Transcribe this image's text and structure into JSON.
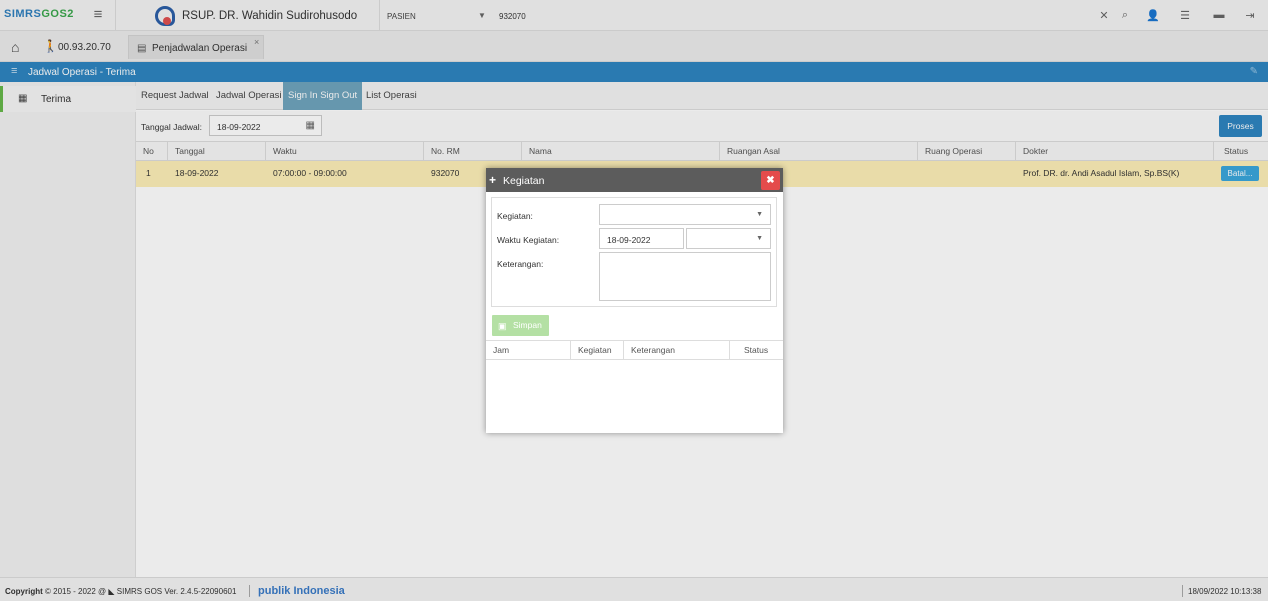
{
  "topbar": {
    "logo_a": "SIMRS",
    "logo_b": "GOS2",
    "hospital_name": "RSUP. DR. Wahidin Sudirohusodo",
    "pasien_label": "PASIEN",
    "pasien_value": "932070",
    "tools": [
      "close-icon",
      "search-icon",
      "add-user-icon",
      "list-icon",
      "folder-icon",
      "logout-icon"
    ]
  },
  "bar2": {
    "rm_text": "00.93.20.70",
    "tab_label": "Penjadwalan Operasi",
    "tab_close": "×"
  },
  "title_bar": {
    "text": "Jadwal Operasi - Terima"
  },
  "sidebar": {
    "items": [
      {
        "label": "Terima"
      }
    ]
  },
  "subtabs": [
    {
      "label": "Request Jadwal",
      "active": false
    },
    {
      "label": "Jadwal Operasi",
      "active": false
    },
    {
      "label": "Sign In Sign Out",
      "active": true
    },
    {
      "label": "List Operasi",
      "active": false
    }
  ],
  "filter": {
    "label": "Tanggal Jadwal:",
    "date": "18-09-2022",
    "proses": "Proses"
  },
  "table": {
    "headers": [
      "No",
      "Tanggal",
      "Waktu",
      "No. RM",
      "Nama",
      "Ruangan Asal",
      "Ruang Operasi",
      "Dokter",
      "Status"
    ],
    "row": {
      "no": "1",
      "tanggal": "18-09-2022",
      "waktu": "07:00:00 - 09:00:00",
      "no_rm": "932070",
      "nama": "",
      "ruangan_asal": "",
      "ruang_operasi": "",
      "dokter": "Prof. DR. dr. Andi Asadul Islam, Sp.BS(K)",
      "status": "Batal..."
    }
  },
  "modal": {
    "title": "Kegiatan",
    "close": "✖",
    "kegiatan_label": "Kegiatan:",
    "waktu_label": "Waktu Kegiatan:",
    "waktu_date": "18-09-2022",
    "keterangan_label": "Keterangan:",
    "simpan": "Simpan",
    "table_headers": [
      "Jam",
      "Kegiatan",
      "Keterangan",
      "Status"
    ]
  },
  "footer": {
    "copyright_bold": "Copyright",
    "copyright_rest": "2015 - 2022 @",
    "version": "SIMRS GOS Ver. 2.4.5-22090601",
    "brand": "publik Indonesia",
    "datetime": "18/09/2022 10:13:38"
  }
}
